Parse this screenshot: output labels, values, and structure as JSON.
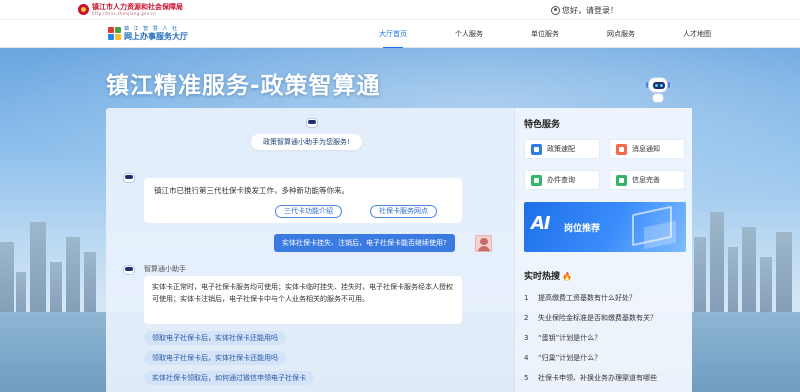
{
  "topbar": {
    "org_name": "镇江市人力资源和社会保障局",
    "org_url": "http://hrss.zhenjiang.gov.cn",
    "login_text": "您好，请登录！"
  },
  "nav": {
    "brand_top": "镇 江 智 慧 人 社",
    "brand_bottom": "网上办事服务大厅",
    "items": [
      "大厅首页",
      "个人服务",
      "单位服务",
      "网点服务",
      "人才地图"
    ]
  },
  "hero": {
    "title": "镇江精准服务-政策智算通"
  },
  "chat": {
    "welcome": "政策智算通小助手为您服务!",
    "bot_msg1": "镇江市已推行第三代社保卡换发工作，多种新功能等你来。",
    "bot_msg1_chips": [
      "三代卡功能介绍",
      "社保卡服务网点"
    ],
    "user_msg": "实体社保卡挂失、注销后，电子社保卡能否继续使用?",
    "bot_name": "智算通小助手",
    "bot_msg2": "实体卡正常时，电子社保卡服务均可使用；实体卡临时挂失、挂失时，电子社保卡服务经本人授权可使用；实体卡注销后，电子社保卡中与个人业务相关的服务不可用。",
    "suggestions": [
      "领取电子社保卡后，实体社保卡还能用吗",
      "领取电子社保卡后，实体社保卡还能用吗",
      "实体社保卡领取后，如何通过微信申领电子社保卡"
    ]
  },
  "side": {
    "features_title": "特色服务",
    "services": [
      {
        "label": "政策速配",
        "color": "#2f7de1"
      },
      {
        "label": "消息通知",
        "color": "#f26b4a"
      },
      {
        "label": "办件查询",
        "color": "#35b46a"
      },
      {
        "label": "信息完善",
        "color": "#35b46a"
      }
    ],
    "banner_ai": "AI",
    "banner_text": "岗位推荐",
    "hot_title": "实时热搜",
    "hot_items": [
      {
        "num": "1",
        "text": "提高缴费工资基数有什么好处？"
      },
      {
        "num": "2",
        "text": "失业保险金标准是否和缴费基数有关？"
      },
      {
        "num": "3",
        "text": "“蛋钥”计划是什么？"
      },
      {
        "num": "4",
        "text": "“归巢”计划是什么？"
      },
      {
        "num": "5",
        "text": "社保卡申领、补换业务办理渠道有哪些"
      }
    ]
  }
}
